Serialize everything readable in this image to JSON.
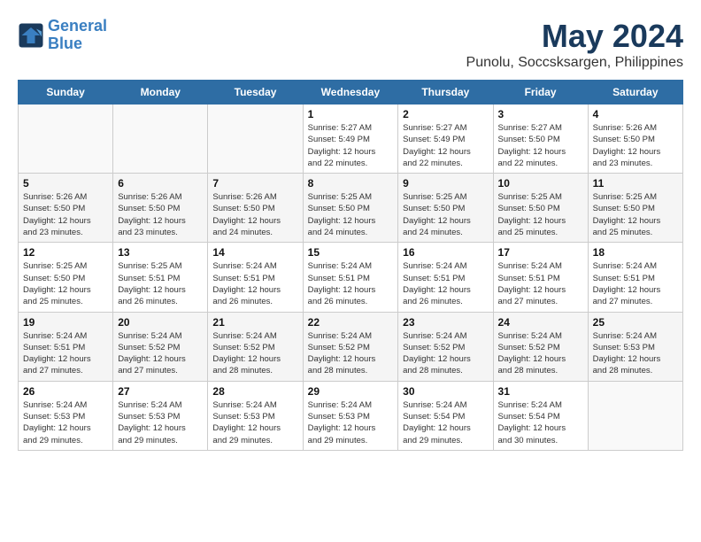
{
  "header": {
    "logo_line1": "General",
    "logo_line2": "Blue",
    "month_title": "May 2024",
    "location": "Punolu, Soccsksargen, Philippines"
  },
  "days_of_week": [
    "Sunday",
    "Monday",
    "Tuesday",
    "Wednesday",
    "Thursday",
    "Friday",
    "Saturday"
  ],
  "weeks": [
    [
      {
        "day": "",
        "info": ""
      },
      {
        "day": "",
        "info": ""
      },
      {
        "day": "",
        "info": ""
      },
      {
        "day": "1",
        "info": "Sunrise: 5:27 AM\nSunset: 5:49 PM\nDaylight: 12 hours\nand 22 minutes."
      },
      {
        "day": "2",
        "info": "Sunrise: 5:27 AM\nSunset: 5:49 PM\nDaylight: 12 hours\nand 22 minutes."
      },
      {
        "day": "3",
        "info": "Sunrise: 5:27 AM\nSunset: 5:50 PM\nDaylight: 12 hours\nand 22 minutes."
      },
      {
        "day": "4",
        "info": "Sunrise: 5:26 AM\nSunset: 5:50 PM\nDaylight: 12 hours\nand 23 minutes."
      }
    ],
    [
      {
        "day": "5",
        "info": "Sunrise: 5:26 AM\nSunset: 5:50 PM\nDaylight: 12 hours\nand 23 minutes."
      },
      {
        "day": "6",
        "info": "Sunrise: 5:26 AM\nSunset: 5:50 PM\nDaylight: 12 hours\nand 23 minutes."
      },
      {
        "day": "7",
        "info": "Sunrise: 5:26 AM\nSunset: 5:50 PM\nDaylight: 12 hours\nand 24 minutes."
      },
      {
        "day": "8",
        "info": "Sunrise: 5:25 AM\nSunset: 5:50 PM\nDaylight: 12 hours\nand 24 minutes."
      },
      {
        "day": "9",
        "info": "Sunrise: 5:25 AM\nSunset: 5:50 PM\nDaylight: 12 hours\nand 24 minutes."
      },
      {
        "day": "10",
        "info": "Sunrise: 5:25 AM\nSunset: 5:50 PM\nDaylight: 12 hours\nand 25 minutes."
      },
      {
        "day": "11",
        "info": "Sunrise: 5:25 AM\nSunset: 5:50 PM\nDaylight: 12 hours\nand 25 minutes."
      }
    ],
    [
      {
        "day": "12",
        "info": "Sunrise: 5:25 AM\nSunset: 5:50 PM\nDaylight: 12 hours\nand 25 minutes."
      },
      {
        "day": "13",
        "info": "Sunrise: 5:25 AM\nSunset: 5:51 PM\nDaylight: 12 hours\nand 26 minutes."
      },
      {
        "day": "14",
        "info": "Sunrise: 5:24 AM\nSunset: 5:51 PM\nDaylight: 12 hours\nand 26 minutes."
      },
      {
        "day": "15",
        "info": "Sunrise: 5:24 AM\nSunset: 5:51 PM\nDaylight: 12 hours\nand 26 minutes."
      },
      {
        "day": "16",
        "info": "Sunrise: 5:24 AM\nSunset: 5:51 PM\nDaylight: 12 hours\nand 26 minutes."
      },
      {
        "day": "17",
        "info": "Sunrise: 5:24 AM\nSunset: 5:51 PM\nDaylight: 12 hours\nand 27 minutes."
      },
      {
        "day": "18",
        "info": "Sunrise: 5:24 AM\nSunset: 5:51 PM\nDaylight: 12 hours\nand 27 minutes."
      }
    ],
    [
      {
        "day": "19",
        "info": "Sunrise: 5:24 AM\nSunset: 5:51 PM\nDaylight: 12 hours\nand 27 minutes."
      },
      {
        "day": "20",
        "info": "Sunrise: 5:24 AM\nSunset: 5:52 PM\nDaylight: 12 hours\nand 27 minutes."
      },
      {
        "day": "21",
        "info": "Sunrise: 5:24 AM\nSunset: 5:52 PM\nDaylight: 12 hours\nand 28 minutes."
      },
      {
        "day": "22",
        "info": "Sunrise: 5:24 AM\nSunset: 5:52 PM\nDaylight: 12 hours\nand 28 minutes."
      },
      {
        "day": "23",
        "info": "Sunrise: 5:24 AM\nSunset: 5:52 PM\nDaylight: 12 hours\nand 28 minutes."
      },
      {
        "day": "24",
        "info": "Sunrise: 5:24 AM\nSunset: 5:52 PM\nDaylight: 12 hours\nand 28 minutes."
      },
      {
        "day": "25",
        "info": "Sunrise: 5:24 AM\nSunset: 5:53 PM\nDaylight: 12 hours\nand 28 minutes."
      }
    ],
    [
      {
        "day": "26",
        "info": "Sunrise: 5:24 AM\nSunset: 5:53 PM\nDaylight: 12 hours\nand 29 minutes."
      },
      {
        "day": "27",
        "info": "Sunrise: 5:24 AM\nSunset: 5:53 PM\nDaylight: 12 hours\nand 29 minutes."
      },
      {
        "day": "28",
        "info": "Sunrise: 5:24 AM\nSunset: 5:53 PM\nDaylight: 12 hours\nand 29 minutes."
      },
      {
        "day": "29",
        "info": "Sunrise: 5:24 AM\nSunset: 5:53 PM\nDaylight: 12 hours\nand 29 minutes."
      },
      {
        "day": "30",
        "info": "Sunrise: 5:24 AM\nSunset: 5:54 PM\nDaylight: 12 hours\nand 29 minutes."
      },
      {
        "day": "31",
        "info": "Sunrise: 5:24 AM\nSunset: 5:54 PM\nDaylight: 12 hours\nand 30 minutes."
      },
      {
        "day": "",
        "info": ""
      }
    ]
  ]
}
